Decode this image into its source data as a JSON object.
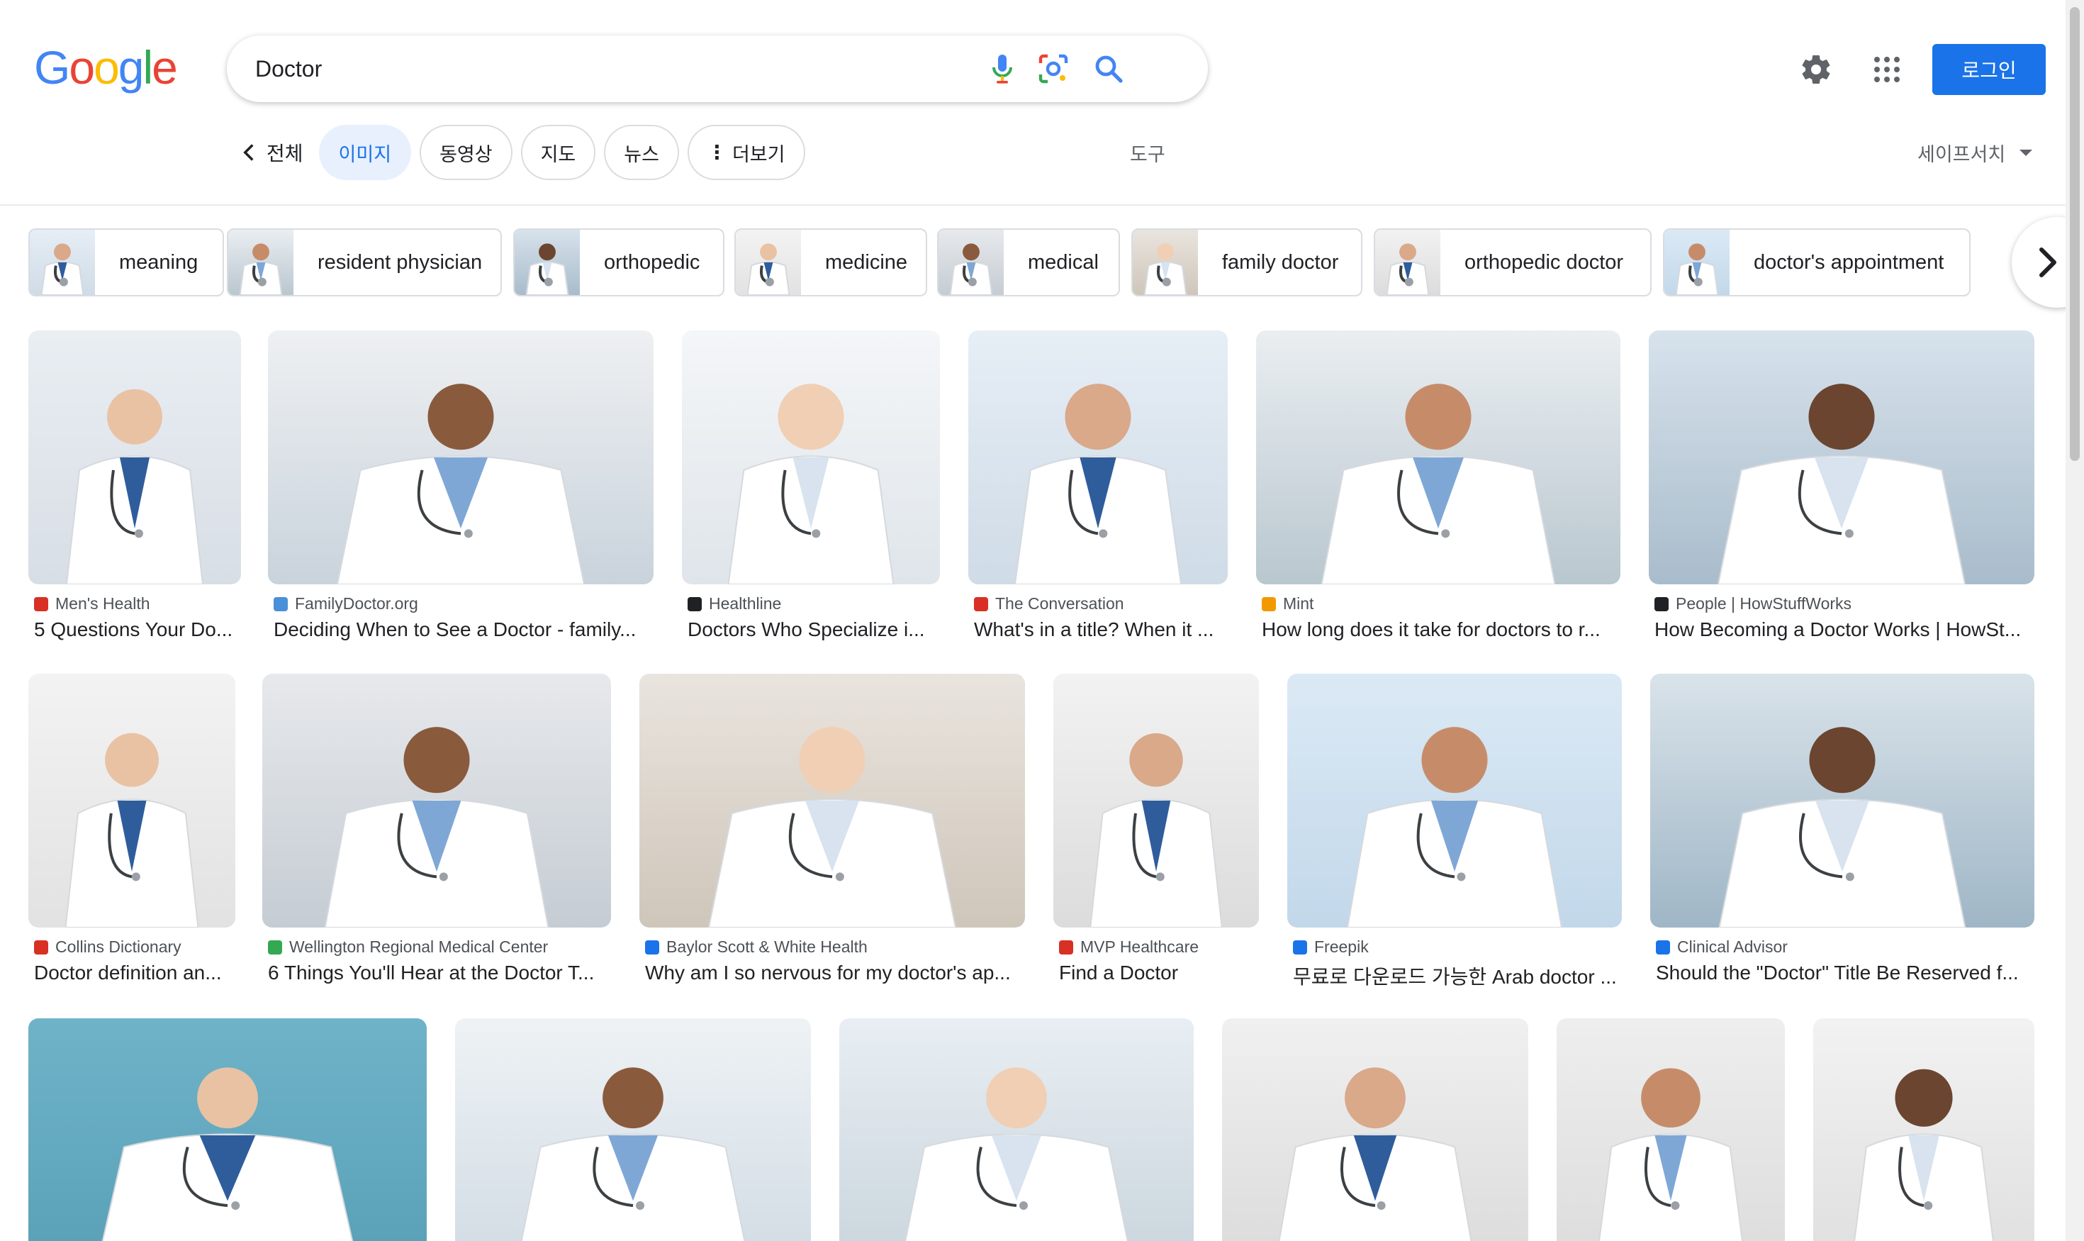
{
  "logo": [
    "G",
    "o",
    "o",
    "g",
    "l",
    "e"
  ],
  "logo_colors": [
    "#4285F4",
    "#EA4335",
    "#FBBC05",
    "#4285F4",
    "#34A853",
    "#EA4335"
  ],
  "search": {
    "value": "Doctor",
    "voice_icon": "mic-icon",
    "lens_icon": "lens-icon",
    "search_icon": "search-icon"
  },
  "header": {
    "settings_icon": "gear-icon",
    "apps_icon": "apps-grid-icon",
    "login_label": "로그인"
  },
  "tabs": {
    "back_label": "전체",
    "items": [
      "이미지",
      "동영상",
      "지도",
      "뉴스",
      "더보기"
    ],
    "tools": "도구",
    "safesearch": "세이프서치"
  },
  "related": [
    "meaning",
    "resident physician",
    "orthopedic",
    "medicine",
    "medical",
    "family doctor",
    "orthopedic doctor",
    "doctor's appointment"
  ],
  "results": [
    {
      "source": "Men's Health",
      "title": "5 Questions Your Do...",
      "fav": "#d93025"
    },
    {
      "source": "FamilyDoctor.org",
      "title": "Deciding When to See a Doctor - family...",
      "fav": "#4a90d9"
    },
    {
      "source": "Healthline",
      "title": "Doctors Who Specialize i...",
      "fav": "#202124"
    },
    {
      "source": "The Conversation",
      "title": "What's in a title? When it ...",
      "fav": "#d93025"
    },
    {
      "source": "Mint",
      "title": "How long does it take for doctors to r...",
      "fav": "#f29900"
    },
    {
      "source": "People | HowStuffWorks",
      "title": "How Becoming a Doctor Works | HowSt...",
      "fav": "#202124"
    },
    {
      "source": "Collins Dictionary",
      "title": "Doctor definition an...",
      "fav": "#d93025"
    },
    {
      "source": "Wellington Regional Medical Center",
      "title": "6 Things You'll Hear at the Doctor T...",
      "fav": "#34a853"
    },
    {
      "source": "Baylor Scott & White Health",
      "title": "Why am I so nervous for my doctor's ap...",
      "fav": "#1a73e8"
    },
    {
      "source": "MVP Healthcare",
      "title": "Find a Doctor",
      "fav": "#d93025"
    },
    {
      "source": "Freepik",
      "title": "무료로 다운로드 가능한 Arab doctor ...",
      "fav": "#1a73e8"
    },
    {
      "source": "Clinical Advisor",
      "title": "Should the \"Doctor\" Title Be Reserved f...",
      "fav": "#1a73e8"
    },
    {
      "source": "",
      "title": "",
      "fav": ""
    },
    {
      "source": "",
      "title": "",
      "fav": ""
    },
    {
      "source": "",
      "title": "",
      "fav": ""
    },
    {
      "source": "",
      "title": "",
      "fav": ""
    },
    {
      "source": "",
      "title": "",
      "fav": ""
    },
    {
      "source": "",
      "title": "",
      "fav": ""
    }
  ],
  "colors": {
    "accent": "#1a73e8",
    "tab_active_bg": "#e8f0fe"
  }
}
